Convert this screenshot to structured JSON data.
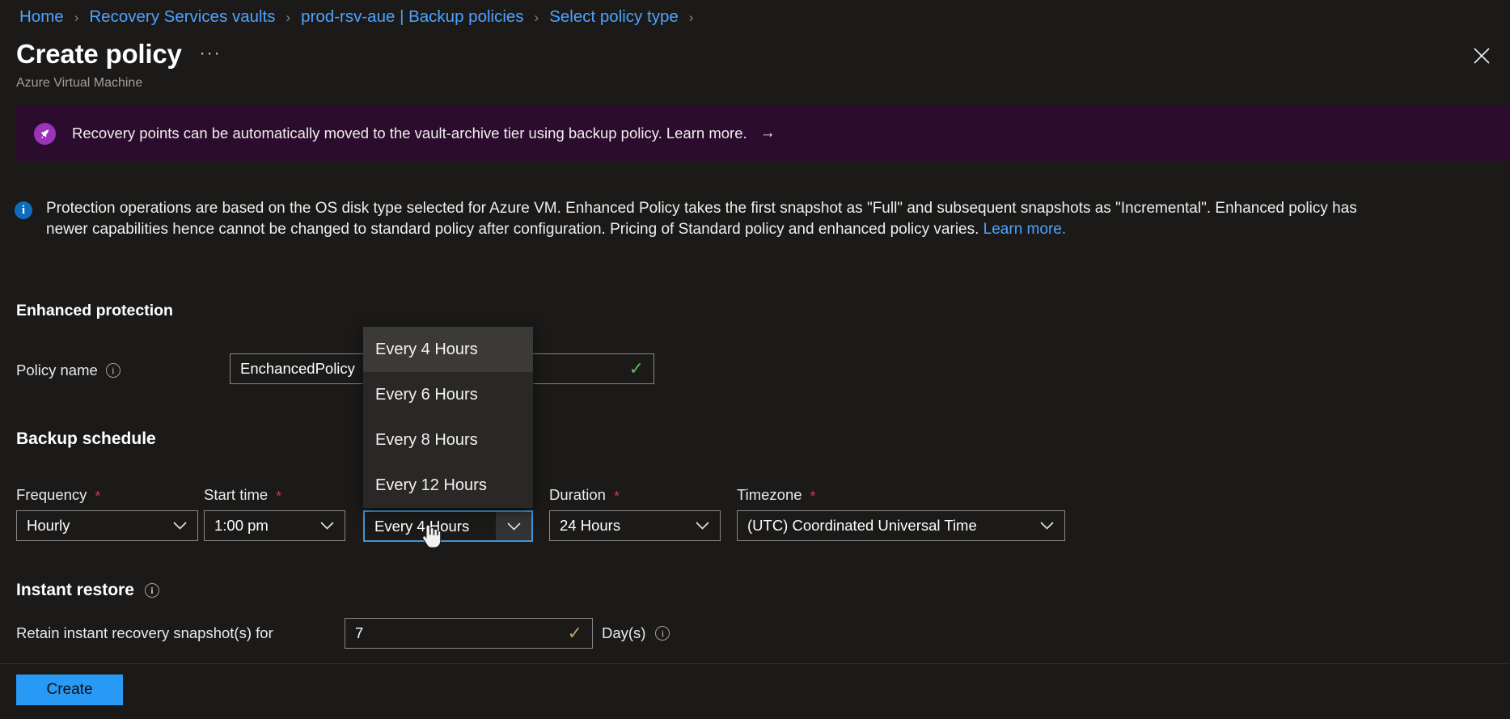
{
  "breadcrumb": {
    "items": [
      {
        "label": "Home"
      },
      {
        "label": "Recovery Services vaults"
      },
      {
        "label": "prod-rsv-aue | Backup policies"
      },
      {
        "label": "Select policy type"
      }
    ],
    "separator": "›"
  },
  "header": {
    "title": "Create policy",
    "more_label": "···",
    "subtitle": "Azure Virtual Machine",
    "close_icon": "close-icon",
    "close_glyph": "✕"
  },
  "promo_banner": {
    "icon": "rocket-icon",
    "icon_glyph": "➤",
    "text": "Recovery points can be automatically moved to the vault-archive tier using backup policy. Learn more.",
    "arrow_glyph": "→",
    "background": "#2c0c2e",
    "icon_background": "#9b35b8"
  },
  "info_message": {
    "icon": "info-icon",
    "icon_glyph": "i",
    "text": "Protection operations are based on the OS disk type selected for Azure VM. Enhanced Policy takes the first snapshot as \"Full\" and subsequent snapshots as \"Incremental\". Enhanced policy has newer capabilities hence cannot be changed to standard policy after configuration. Pricing of Standard policy and enhanced policy varies.",
    "link_label": "Learn more.",
    "icon_background": "#0f6cbd"
  },
  "enhanced_protection": {
    "section_title": "Enhanced protection",
    "policy_name": {
      "label": "Policy name",
      "value": "EnchancedPolicy",
      "valid_glyph": "✓",
      "valid_color": "#5db85c"
    }
  },
  "backup_schedule": {
    "section_title": "Backup schedule",
    "fields": {
      "frequency": {
        "label": "Frequency",
        "required": true,
        "value": "Hourly"
      },
      "start_time": {
        "label": "Start time",
        "required": true,
        "value": "1:00 pm"
      },
      "interval": {
        "label": "",
        "required": false,
        "value": "Every 4 Hours"
      },
      "duration": {
        "label": "Duration",
        "required": true,
        "value": "24 Hours"
      },
      "timezone": {
        "label": "Timezone",
        "required": true,
        "value": "(UTC) Coordinated Universal Time"
      }
    },
    "required_marker": "*",
    "chevron_glyph": "⌄",
    "interval_dropdown": {
      "open": true,
      "selected": "Every 4 Hours",
      "options": [
        "Every 4 Hours",
        "Every 6 Hours",
        "Every 8 Hours",
        "Every 12 Hours"
      ]
    }
  },
  "instant_restore": {
    "section_title": "Instant restore",
    "retain_label": "Retain instant recovery snapshot(s) for",
    "retain_value": "7",
    "retain_valid_glyph": "✓",
    "unit_label": "Day(s)"
  },
  "footer": {
    "create_label": "Create",
    "accent_color": "#2899f5"
  }
}
